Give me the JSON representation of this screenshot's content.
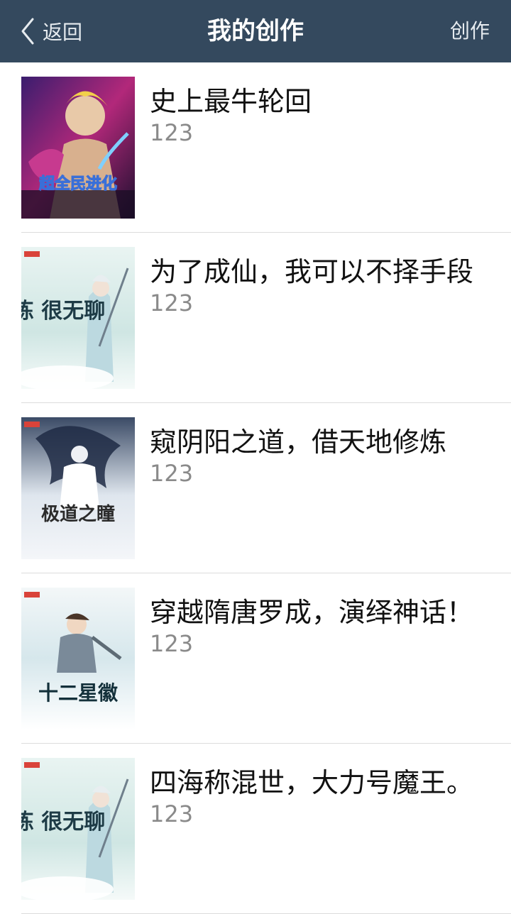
{
  "header": {
    "back_label": "返回",
    "title": "我的创作",
    "action_label": "创作"
  },
  "works": [
    {
      "title": "史上最牛轮回",
      "subtitle": "123",
      "cover_text": "超全民进化"
    },
    {
      "title": "为了成仙，我可以不择手段",
      "subtitle": "123",
      "cover_text": "修炼 很无聊"
    },
    {
      "title": "窥阴阳之道，借天地修炼",
      "subtitle": "123",
      "cover_text": "极道之瞳"
    },
    {
      "title": "穿越隋唐罗成，演绎神话！",
      "subtitle": "123",
      "cover_text": "十二星徽"
    },
    {
      "title": "四海称混世，大力号魔王。",
      "subtitle": "123",
      "cover_text": "修炼 很无聊"
    }
  ]
}
